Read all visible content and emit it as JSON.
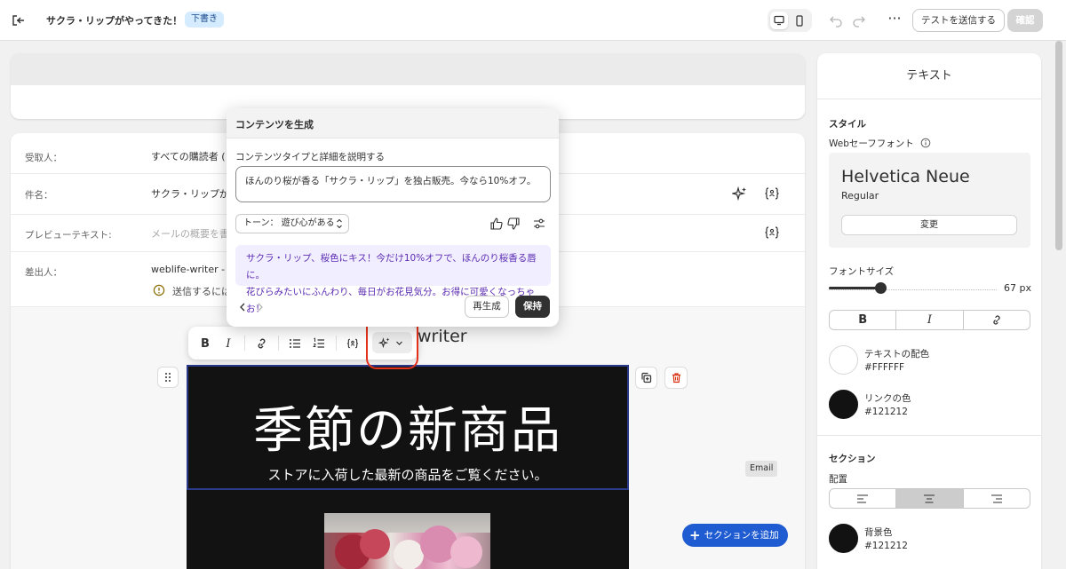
{
  "topbar": {
    "title": "サクラ・リップがやってきた！",
    "status_badge": "下書き",
    "more_label": "···",
    "test_button": "テストを送信する",
    "confirm_button": "確認"
  },
  "header_fields": {
    "recipient_label": "受取人：",
    "recipient_value": "すべての購読者 (",
    "subject_label": "件名：",
    "subject_value": "サクラ・リップが",
    "preview_label": "プレビューテキスト:",
    "preview_placeholder": "メールの概要を書",
    "sender_label": "差出人：",
    "sender_value": "weblife-writer -",
    "sender_warning": "送信するには"
  },
  "ai_popover": {
    "title": "コンテンツを生成",
    "prompt_label": "コンテンツタイプと詳細を説明する",
    "prompt_value": "ほんのり桜が香る「サクラ・リップ」を独占販売。今なら10%オフ。",
    "tone_label": "トーン： 遊び心がある",
    "result_line1": "サクラ・リップ、桜色にキス！今だけ10%オフで、ほんのり桜香る唇に。",
    "result_line2": "花びらみたいにふんわり、毎日がお花見気分。お得に可愛くなっちゃお！",
    "regenerate_button": "再生成",
    "keep_button": "保持"
  },
  "toolbar": {
    "bold": "B",
    "italic": "I",
    "trailing_text": "writer"
  },
  "email": {
    "hero_title": "季節の新商品",
    "hero_subtitle": "ストアに入荷した最新の商品をご覧ください。",
    "email_tag": "Email",
    "add_section_button": "セクションを追加"
  },
  "panel": {
    "title": "テキスト",
    "style_heading": "スタイル",
    "websafe_font_label": "Webセーフフォント",
    "font_name": "Helvetica Neue",
    "font_weight": "Regular",
    "change_button": "変更",
    "font_size_label": "フォントサイズ",
    "font_size_value": "67 px",
    "font_size": 67,
    "format_bold": "B",
    "format_italic": "I",
    "text_color_label": "テキストの配色",
    "text_color_hex": "#FFFFFF",
    "link_color_label": "リンクの色",
    "link_color_hex": "#121212",
    "section_heading": "セクション",
    "alignment_label": "配置",
    "alignment_selected": "center",
    "bg_color_label": "背景色",
    "bg_color_hex": "#121212"
  },
  "colors": {
    "accent_blue": "#1f5bd1",
    "highlight_red": "#e5321b",
    "ai_result_text": "#5b2bb2",
    "hero_background": "#121212"
  }
}
